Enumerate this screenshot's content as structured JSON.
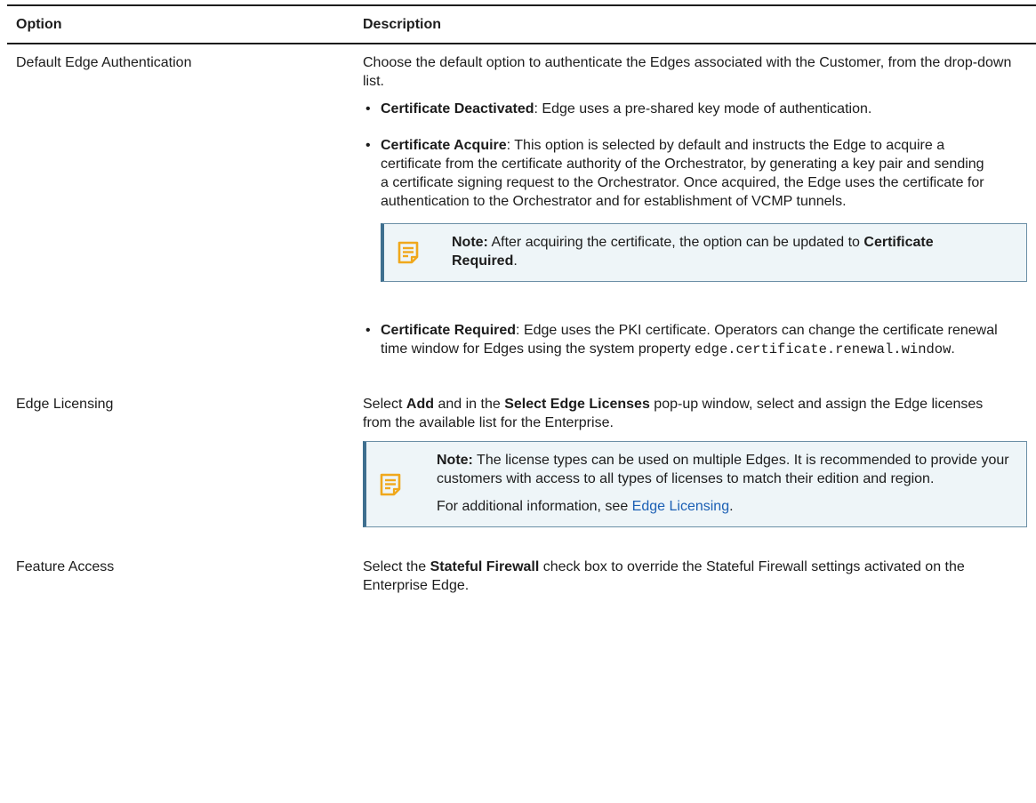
{
  "table": {
    "headers": [
      "Option",
      "Description"
    ],
    "rows": [
      {
        "option": "Default Edge Authentication",
        "intro": "Choose the default option to authenticate the Edges associated with the Customer, from the drop-down list.",
        "bullets": [
          {
            "term": "Certificate Deactivated",
            "text": ": Edge uses a pre-shared key mode of authentication."
          },
          {
            "term": "Certificate Acquire",
            "text": ": This option is selected by default and instructs the Edge to acquire a certificate from the certificate authority of the Orchestrator, by generating a key pair and sending a certificate signing request to the Orchestrator. Once acquired, the Edge uses the certificate for authentication to the Orchestrator and for establishment of VCMP tunnels."
          },
          {
            "term": "Certificate Required",
            "text": ": Edge uses the PKI certificate. Operators can change the certificate renewal time window for Edges using the system property ",
            "code": "edge.certificate.renewal.window",
            "end": "."
          }
        ],
        "note": {
          "label": "Note:",
          "text": " After acquiring the certificate, the option can be updated to ",
          "bold": "Certificate Required",
          "end": "."
        }
      },
      {
        "option": "Edge Licensing",
        "desc_pre": "Select ",
        "desc_b1": "Add",
        "desc_mid": " and in the ",
        "desc_b2": "Select Edge Licenses",
        "desc_post": " pop-up window, select and assign the Edge licenses from the available list for the Enterprise.",
        "note": {
          "label": "Note:",
          "text": " The license types can be used on multiple Edges. It is recommended to provide your customers with access to all types of licenses to match their edition and region.",
          "more": "For additional information, see ",
          "link": "Edge Licensing",
          "end": "."
        }
      },
      {
        "option": "Feature Access",
        "desc_pre": "Select the ",
        "desc_b1": "Stateful Firewall",
        "desc_post": " check box to override the Stateful Firewall settings activated on the Enterprise Edge."
      }
    ]
  },
  "icons": {
    "note": "note-icon",
    "note_color": "#f0a81c"
  }
}
